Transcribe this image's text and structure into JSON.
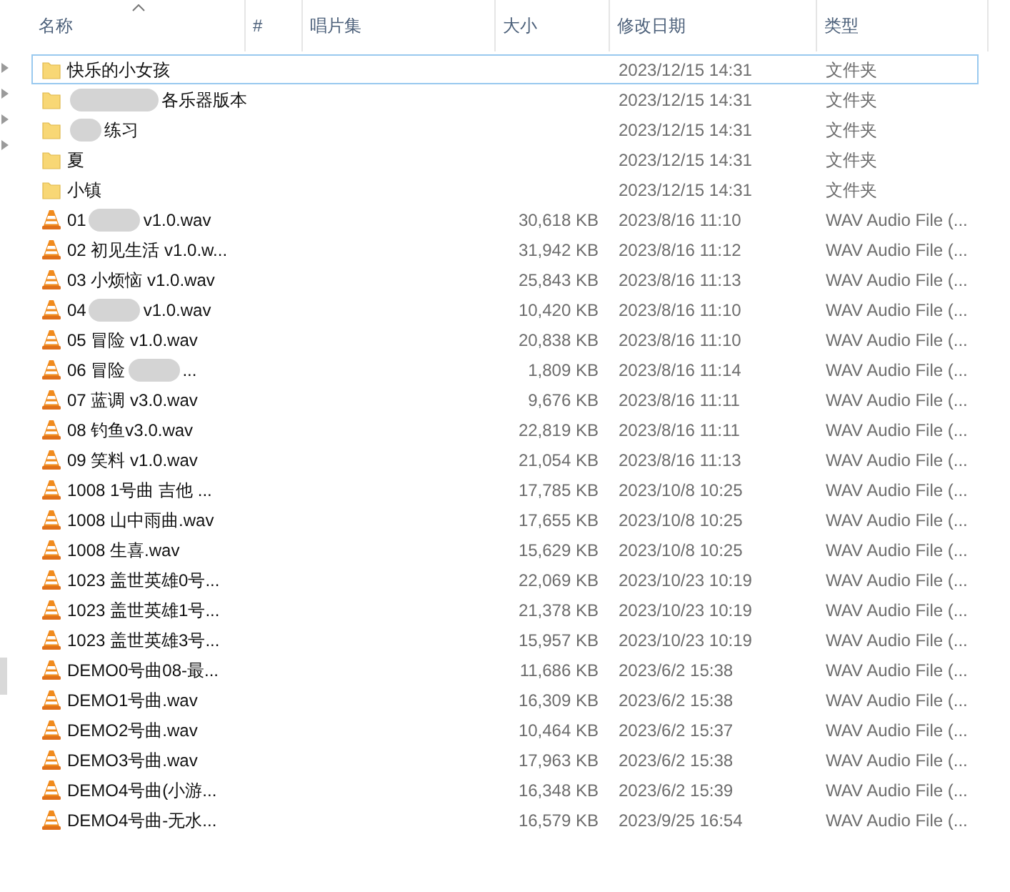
{
  "columns": [
    {
      "label": "名称",
      "sorted": true
    },
    {
      "label": "#",
      "sorted": false
    },
    {
      "label": "唱片集",
      "sorted": false
    },
    {
      "label": "大小",
      "sorted": false
    },
    {
      "label": "修改日期",
      "sorted": false
    },
    {
      "label": "类型",
      "sorted": false
    }
  ],
  "rows": [
    {
      "kind": "folder",
      "selected": true,
      "name": "快乐的小女孩",
      "size": "",
      "date": "2023/12/15 14:31",
      "type": "文件夹"
    },
    {
      "kind": "folder",
      "selected": false,
      "redacted": true,
      "name": "各乐器版本",
      "size": "",
      "date": "2023/12/15 14:31",
      "type": "文件夹"
    },
    {
      "kind": "folder",
      "selected": false,
      "redacted": true,
      "name": "练习",
      "size": "",
      "date": "2023/12/15 14:31",
      "type": "文件夹"
    },
    {
      "kind": "folder",
      "selected": false,
      "name": "夏",
      "size": "",
      "date": "2023/12/15 14:31",
      "type": "文件夹"
    },
    {
      "kind": "folder",
      "selected": false,
      "name": "小镇",
      "size": "",
      "date": "2023/12/15 14:31",
      "type": "文件夹"
    },
    {
      "kind": "audio",
      "selected": false,
      "redacted": true,
      "name": "01",
      "name_end": "v1.0.wav",
      "size": "30,618 KB",
      "date": "2023/8/16 11:10",
      "type": "WAV Audio File (..."
    },
    {
      "kind": "audio",
      "selected": false,
      "name": "02 初见生活 v1.0.w...",
      "size": "31,942 KB",
      "date": "2023/8/16 11:12",
      "type": "WAV Audio File (..."
    },
    {
      "kind": "audio",
      "selected": false,
      "name": "03 小烦恼 v1.0.wav",
      "size": "25,843 KB",
      "date": "2023/8/16 11:13",
      "type": "WAV Audio File (..."
    },
    {
      "kind": "audio",
      "selected": false,
      "redacted": true,
      "name": "04",
      "name_end": "v1.0.wav",
      "size": "10,420 KB",
      "date": "2023/8/16 11:10",
      "type": "WAV Audio File (..."
    },
    {
      "kind": "audio",
      "selected": false,
      "name": "05 冒险 v1.0.wav",
      "size": "20,838 KB",
      "date": "2023/8/16 11:10",
      "type": "WAV Audio File (..."
    },
    {
      "kind": "audio",
      "selected": false,
      "redacted": true,
      "name": "06 冒险",
      "name_end": "...",
      "size": "1,809 KB",
      "date": "2023/8/16 11:14",
      "type": "WAV Audio File (..."
    },
    {
      "kind": "audio",
      "selected": false,
      "name": "07 蓝调 v3.0.wav",
      "size": "9,676 KB",
      "date": "2023/8/16 11:11",
      "type": "WAV Audio File (..."
    },
    {
      "kind": "audio",
      "selected": false,
      "name": "08 钓鱼v3.0.wav",
      "size": "22,819 KB",
      "date": "2023/8/16 11:11",
      "type": "WAV Audio File (..."
    },
    {
      "kind": "audio",
      "selected": false,
      "name": "09 笑料 v1.0.wav",
      "size": "21,054 KB",
      "date": "2023/8/16 11:13",
      "type": "WAV Audio File (..."
    },
    {
      "kind": "audio",
      "selected": false,
      "name": "1008 1号曲 吉他 ...",
      "size": "17,785 KB",
      "date": "2023/10/8 10:25",
      "type": "WAV Audio File (..."
    },
    {
      "kind": "audio",
      "selected": false,
      "name": "1008 山中雨曲.wav",
      "size": "17,655 KB",
      "date": "2023/10/8 10:25",
      "type": "WAV Audio File (..."
    },
    {
      "kind": "audio",
      "selected": false,
      "name": "1008 生喜.wav",
      "size": "15,629 KB",
      "date": "2023/10/8 10:25",
      "type": "WAV Audio File (..."
    },
    {
      "kind": "audio",
      "selected": false,
      "name": "1023 盖世英雄0号...",
      "size": "22,069 KB",
      "date": "2023/10/23 10:19",
      "type": "WAV Audio File (..."
    },
    {
      "kind": "audio",
      "selected": false,
      "name": "1023 盖世英雄1号...",
      "size": "21,378 KB",
      "date": "2023/10/23 10:19",
      "type": "WAV Audio File (..."
    },
    {
      "kind": "audio",
      "selected": false,
      "name": "1023 盖世英雄3号...",
      "size": "15,957 KB",
      "date": "2023/10/23 10:19",
      "type": "WAV Audio File (..."
    },
    {
      "kind": "audio",
      "selected": false,
      "name": "DEMO0号曲08-最...",
      "size": "11,686 KB",
      "date": "2023/6/2 15:38",
      "type": "WAV Audio File (..."
    },
    {
      "kind": "audio",
      "selected": false,
      "name": "DEMO1号曲.wav",
      "size": "16,309 KB",
      "date": "2023/6/2 15:38",
      "type": "WAV Audio File (..."
    },
    {
      "kind": "audio",
      "selected": false,
      "name": "DEMO2号曲.wav",
      "size": "10,464 KB",
      "date": "2023/6/2 15:37",
      "type": "WAV Audio File (..."
    },
    {
      "kind": "audio",
      "selected": false,
      "name": "DEMO3号曲.wav",
      "size": "17,963 KB",
      "date": "2023/6/2 15:38",
      "type": "WAV Audio File (..."
    },
    {
      "kind": "audio",
      "selected": false,
      "name": "DEMO4号曲(小游...",
      "size": "16,348 KB",
      "date": "2023/6/2 15:39",
      "type": "WAV Audio File (..."
    },
    {
      "kind": "audio",
      "selected": false,
      "name": "DEMO4号曲-无水...",
      "size": "16,579 KB",
      "date": "2023/9/25 16:54",
      "type": "WAV Audio File (..."
    }
  ]
}
